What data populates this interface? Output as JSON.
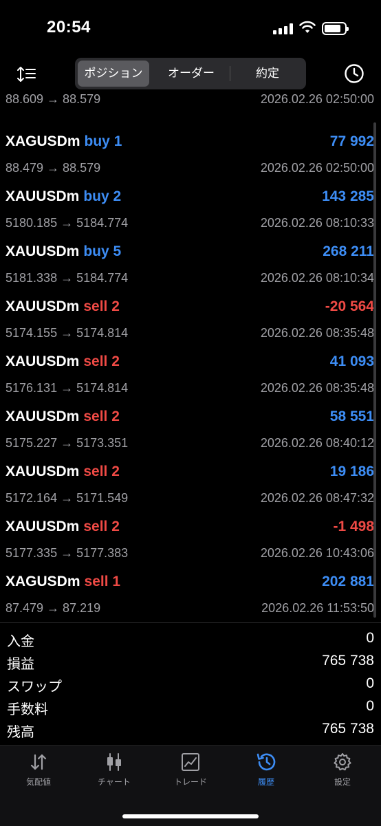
{
  "status": {
    "time": "20:54"
  },
  "header": {
    "tabs": [
      {
        "label": "ポジション",
        "active": true
      },
      {
        "label": "オーダー",
        "active": false
      },
      {
        "label": "約定",
        "active": false
      }
    ]
  },
  "rows": [
    {
      "symbol": "",
      "side": "",
      "side_type": "buy",
      "pl": "",
      "pl_type": "pos",
      "prices": "88.609 → 88.579",
      "datetime": "2026.02.26 02:50:00"
    },
    {
      "symbol": "XAGUSDm",
      "side": "buy 1",
      "side_type": "buy",
      "pl": "77 992",
      "pl_type": "pos",
      "prices": "88.479 → 88.579",
      "datetime": "2026.02.26 02:50:00"
    },
    {
      "symbol": "XAUUSDm",
      "side": "buy 2",
      "side_type": "buy",
      "pl": "143 285",
      "pl_type": "pos",
      "prices": "5180.185 → 5184.774",
      "datetime": "2026.02.26 08:10:33"
    },
    {
      "symbol": "XAUUSDm",
      "side": "buy 5",
      "side_type": "buy",
      "pl": "268 211",
      "pl_type": "pos",
      "prices": "5181.338 → 5184.774",
      "datetime": "2026.02.26 08:10:34"
    },
    {
      "symbol": "XAUUSDm",
      "side": "sell 2",
      "side_type": "sell",
      "pl": "-20 564",
      "pl_type": "neg",
      "prices": "5174.155 → 5174.814",
      "datetime": "2026.02.26 08:35:48"
    },
    {
      "symbol": "XAUUSDm",
      "side": "sell 2",
      "side_type": "sell",
      "pl": "41 093",
      "pl_type": "pos",
      "prices": "5176.131 → 5174.814",
      "datetime": "2026.02.26 08:35:48"
    },
    {
      "symbol": "XAUUSDm",
      "side": "sell 2",
      "side_type": "sell",
      "pl": "58 551",
      "pl_type": "pos",
      "prices": "5175.227 → 5173.351",
      "datetime": "2026.02.26 08:40:12"
    },
    {
      "symbol": "XAUUSDm",
      "side": "sell 2",
      "side_type": "sell",
      "pl": "19 186",
      "pl_type": "pos",
      "prices": "5172.164 → 5171.549",
      "datetime": "2026.02.26 08:47:32"
    },
    {
      "symbol": "XAUUSDm",
      "side": "sell 2",
      "side_type": "sell",
      "pl": "-1 498",
      "pl_type": "neg",
      "prices": "5177.335 → 5177.383",
      "datetime": "2026.02.26 10:43:06"
    },
    {
      "symbol": "XAGUSDm",
      "side": "sell 1",
      "side_type": "sell",
      "pl": "202 881",
      "pl_type": "pos",
      "prices": "87.479 → 87.219",
      "datetime": "2026.02.26 11:53:50"
    }
  ],
  "summary": [
    {
      "label": "入金",
      "value": "0"
    },
    {
      "label": "損益",
      "value": "765 738"
    },
    {
      "label": "スワップ",
      "value": "0"
    },
    {
      "label": "手数料",
      "value": "0"
    },
    {
      "label": "残高",
      "value": "765 738"
    }
  ],
  "tabbar": [
    {
      "label": "気配値",
      "icon": "arrows-updown-icon",
      "active": false
    },
    {
      "label": "チャート",
      "icon": "candlestick-icon",
      "active": false
    },
    {
      "label": "トレード",
      "icon": "trade-chart-icon",
      "active": false
    },
    {
      "label": "履歴",
      "icon": "history-icon",
      "active": true
    },
    {
      "label": "設定",
      "icon": "gear-icon",
      "active": false
    }
  ],
  "colors": {
    "buy": "#3d8df5",
    "sell": "#ef4a45",
    "muted": "#a0a0a5",
    "accent": "#3d8df5"
  }
}
